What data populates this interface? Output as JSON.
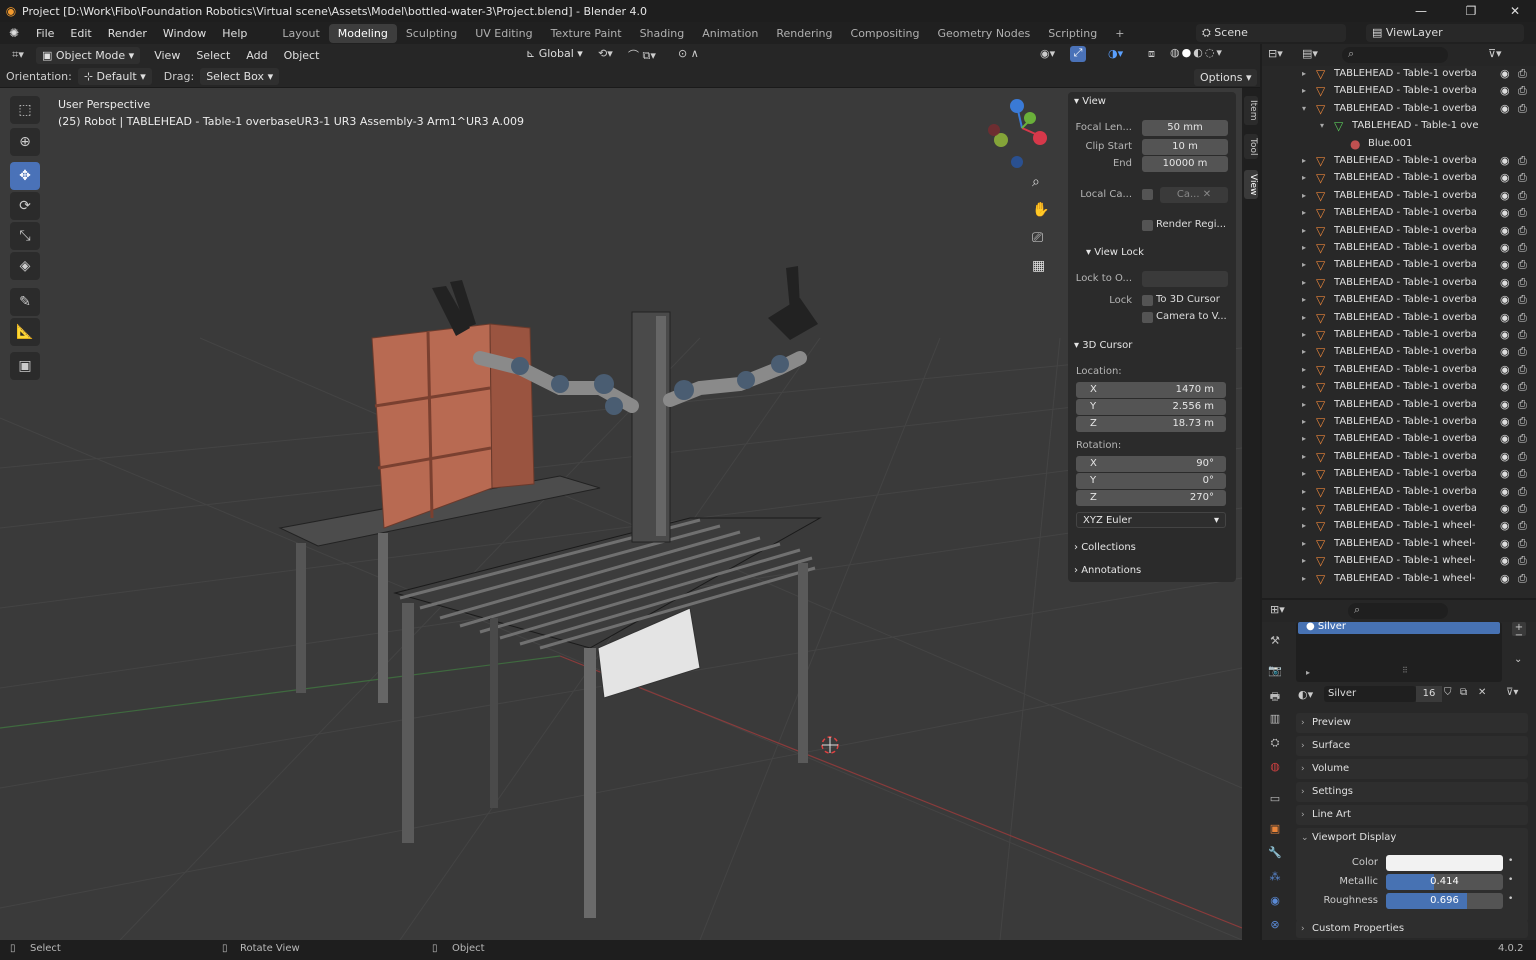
{
  "window": {
    "title": "Project [D:\\Work\\Fibo\\Foundation Robotics\\Virtual scene\\Assets\\Model\\bottled-water-3\\Project.blend] - Blender 4.0"
  },
  "menu": [
    "File",
    "Edit",
    "Render",
    "Window",
    "Help"
  ],
  "workspaces": [
    "Layout",
    "Modeling",
    "Sculpting",
    "UV Editing",
    "Texture Paint",
    "Shading",
    "Animation",
    "Rendering",
    "Compositing",
    "Geometry Nodes",
    "Scripting"
  ],
  "active_workspace": "Modeling",
  "scene": {
    "label": "Scene",
    "viewlayer": "ViewLayer"
  },
  "header": {
    "mode": "Object Mode",
    "view": "View",
    "select": "Select",
    "add": "Add",
    "object": "Object",
    "transform": "Global"
  },
  "header2": {
    "orientation_label": "Orientation:",
    "orientation_value": "Default",
    "drag_label": "Drag:",
    "drag_value": "Select Box",
    "options": "Options"
  },
  "overlay": {
    "perspective": "User Perspective",
    "info": "(25) Robot | TABLEHEAD - Table-1 overbaseUR3-1 UR3 Assembly-3 Arm1^UR3 A.009"
  },
  "npanel": {
    "tabs": [
      "Item",
      "Tool",
      "View"
    ],
    "view_header": "View",
    "focal_label": "Focal Len...",
    "focal_value": "50 mm",
    "clip_start_label": "Clip Start",
    "clip_start_value": "10 m",
    "clip_end_label": "End",
    "clip_end_value": "10000 m",
    "local_camera_label": "Local Ca...",
    "local_camera_value": "Ca...",
    "render_region": "Render Regi...",
    "view_lock_header": "View Lock",
    "lock_obj_label": "Lock to O...",
    "lock_label": "Lock",
    "to_cursor": "To 3D Cursor",
    "camera_to_view": "Camera to V...",
    "cursor_header": "3D Cursor",
    "location_label": "Location:",
    "loc": {
      "x": "1470 m",
      "y": "2.556 m",
      "z": "18.73 m"
    },
    "rotation_label": "Rotation:",
    "rot": {
      "x": "90°",
      "y": "0°",
      "z": "270°"
    },
    "rot_mode": "XYZ Euler",
    "axis": {
      "x": "X",
      "y": "Y",
      "z": "Z"
    },
    "collections": "Collections",
    "annotations": "Annotations"
  },
  "outliner": {
    "rows": [
      "TABLEHEAD - Table-1 overba",
      "TABLEHEAD - Table-1 overba",
      "TABLEHEAD - Table-1 overba",
      "TABLEHEAD - Table-1 ove",
      "Blue.001",
      "TABLEHEAD - Table-1 overba",
      "TABLEHEAD - Table-1 overba",
      "TABLEHEAD - Table-1 overba",
      "TABLEHEAD - Table-1 overba",
      "TABLEHEAD - Table-1 overba",
      "TABLEHEAD - Table-1 overba",
      "TABLEHEAD - Table-1 overba",
      "TABLEHEAD - Table-1 overba",
      "TABLEHEAD - Table-1 overba",
      "TABLEHEAD - Table-1 overba",
      "TABLEHEAD - Table-1 overba",
      "TABLEHEAD - Table-1 overba",
      "TABLEHEAD - Table-1 overba",
      "TABLEHEAD - Table-1 overba",
      "TABLEHEAD - Table-1 overba",
      "TABLEHEAD - Table-1 overba",
      "TABLEHEAD - Table-1 overba",
      "TABLEHEAD - Table-1 overba",
      "TABLEHEAD - Table-1 overba",
      "TABLEHEAD - Table-1 overba",
      "TABLEHEAD - Table-1 overba",
      "TABLEHEAD - Table-1 wheel-",
      "TABLEHEAD - Table-1 wheel-",
      "TABLEHEAD - Table-1 wheel-",
      "TABLEHEAD - Table-1 wheel-"
    ]
  },
  "properties": {
    "slot": "Silver",
    "material_name": "Silver",
    "users": "16",
    "sections": [
      "Preview",
      "Surface",
      "Volume",
      "Settings",
      "Line Art",
      "Viewport Display",
      "Custom Properties"
    ],
    "color_label": "Color",
    "color": "#f2f2f2",
    "metallic_label": "Metallic",
    "metallic": "0.414",
    "roughness_label": "Roughness",
    "roughness": "0.696"
  },
  "status": {
    "select": "Select",
    "rotate": "Rotate View",
    "object": "Object",
    "version": "4.0.2"
  },
  "colors": {
    "accent": "#4a72b8",
    "slider": "#4772b3",
    "box": "#b86a52"
  }
}
